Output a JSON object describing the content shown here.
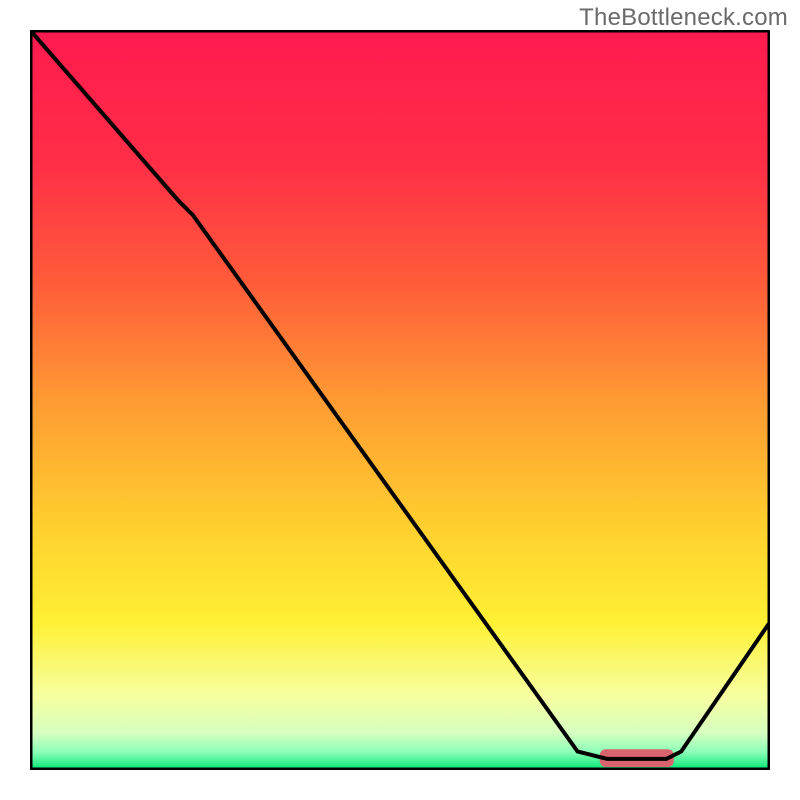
{
  "watermark": "TheBottleneck.com",
  "chart_data": {
    "type": "line",
    "title": "",
    "xlabel": "",
    "ylabel": "",
    "xlim": [
      0,
      100
    ],
    "ylim": [
      0,
      100
    ],
    "grid": false,
    "legend": false,
    "x": [
      0,
      20,
      22,
      74,
      78,
      86,
      88,
      100
    ],
    "values": [
      100,
      77,
      75,
      2.5,
      1.5,
      1.5,
      2.5,
      20
    ],
    "marker": {
      "x_center": 82,
      "y": 1.6,
      "width": 10,
      "height": 2.4
    },
    "gradient_stops": [
      {
        "pos": 0.0,
        "color": "#ff1a4f"
      },
      {
        "pos": 0.18,
        "color": "#ff2e47"
      },
      {
        "pos": 0.34,
        "color": "#ff5b3a"
      },
      {
        "pos": 0.5,
        "color": "#ff9a33"
      },
      {
        "pos": 0.66,
        "color": "#ffcc2e"
      },
      {
        "pos": 0.8,
        "color": "#fff033"
      },
      {
        "pos": 0.9,
        "color": "#f7ffa0"
      },
      {
        "pos": 0.95,
        "color": "#d6ffc0"
      },
      {
        "pos": 0.975,
        "color": "#8fffb8"
      },
      {
        "pos": 1.0,
        "color": "#00e673"
      }
    ]
  }
}
